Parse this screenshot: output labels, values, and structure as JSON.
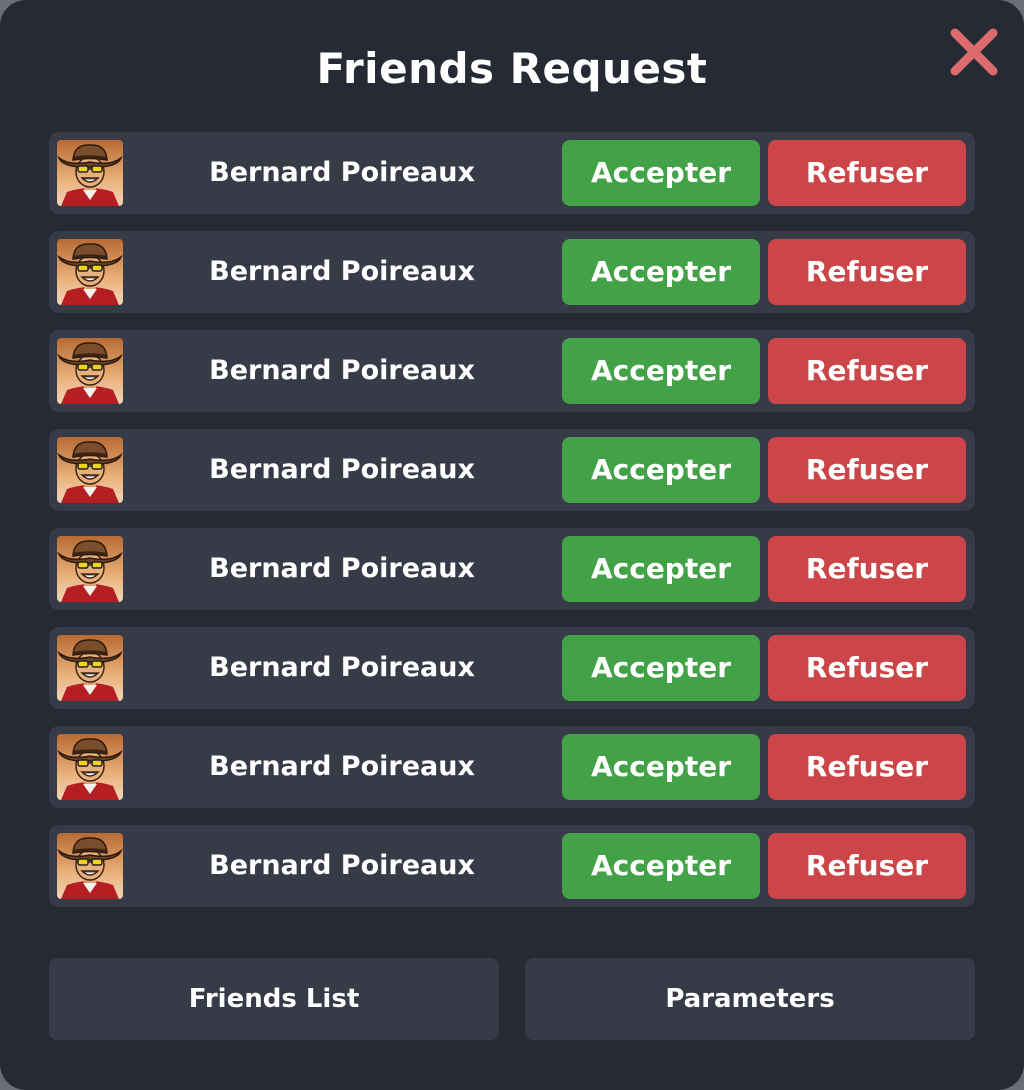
{
  "dialog": {
    "title": "Friends Request",
    "close_icon": "close-x-icon",
    "close_color": "#d96b6b"
  },
  "requests": [
    {
      "name": "Bernard Poireaux",
      "accept_label": "Accepter",
      "refuse_label": "Refuser",
      "avatar_icon": "cowboy-avatar-icon"
    },
    {
      "name": "Bernard Poireaux",
      "accept_label": "Accepter",
      "refuse_label": "Refuser",
      "avatar_icon": "cowboy-avatar-icon"
    },
    {
      "name": "Bernard Poireaux",
      "accept_label": "Accepter",
      "refuse_label": "Refuser",
      "avatar_icon": "cowboy-avatar-icon"
    },
    {
      "name": "Bernard Poireaux",
      "accept_label": "Accepter",
      "refuse_label": "Refuser",
      "avatar_icon": "cowboy-avatar-icon"
    },
    {
      "name": "Bernard Poireaux",
      "accept_label": "Accepter",
      "refuse_label": "Refuser",
      "avatar_icon": "cowboy-avatar-icon"
    },
    {
      "name": "Bernard Poireaux",
      "accept_label": "Accepter",
      "refuse_label": "Refuser",
      "avatar_icon": "cowboy-avatar-icon"
    },
    {
      "name": "Bernard Poireaux",
      "accept_label": "Accepter",
      "refuse_label": "Refuser",
      "avatar_icon": "cowboy-avatar-icon"
    },
    {
      "name": "Bernard Poireaux",
      "accept_label": "Accepter",
      "refuse_label": "Refuser",
      "avatar_icon": "cowboy-avatar-icon"
    }
  ],
  "footer": {
    "friends_list_label": "Friends List",
    "parameters_label": "Parameters"
  },
  "colors": {
    "panel_bg": "#252a35",
    "row_bg": "#363b47",
    "accept_bg": "#43a148",
    "refuse_bg": "#cc4548"
  }
}
